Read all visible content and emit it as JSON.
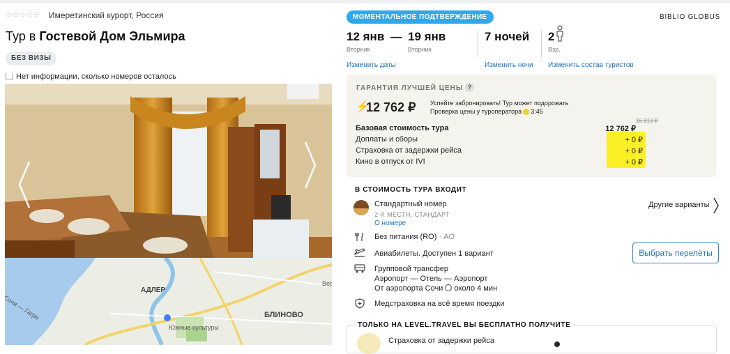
{
  "hotel": {
    "stars_glyph": "☆☆☆☆☆",
    "location": "Имеретинский курорт, Россия",
    "title_prefix": "Тур в",
    "title_name": "Гостевой Дом Эльмира",
    "visa_badge": "БЕЗ ВИЗЫ",
    "rooms_info": "Нет информации, сколько номеров осталось"
  },
  "map": {
    "labels": [
      "АДЛЕР",
      "БЛИНОВО",
      "Сочи — Гагре",
      "Южные культуры",
      "Вер"
    ]
  },
  "booking": {
    "instant_badge": "МОМЕНТАЛЬНОЕ ПОДТВЕРЖДЕНИЕ",
    "operator": "BIBLIO GLOBUS",
    "date_from": "12 янв",
    "date_dash": "—",
    "date_to": "19 янв",
    "day_from": "Вторник",
    "day_to": "Вторник",
    "nights": "7 ночей",
    "tourists_count": "2",
    "tourists_label": "Взр.",
    "change_dates": "Изменить даты",
    "change_nights": "Изменить ночи",
    "change_tourists": "Изменить состав туристов"
  },
  "guarantee": {
    "label": "ГАРАНТИЯ ЛУЧШЕЙ ЦЕНЫ",
    "help": "?",
    "price": "12 762 ₽",
    "hint_line1": "Успейте забронировать! Тур может подорожать",
    "hint_line2": "Проверка цены у туроператора",
    "timer": "3:45",
    "rows": [
      {
        "label": "Базовая стоимость тура",
        "value": "12 762 ₽",
        "old": "16 813 ₽"
      },
      {
        "label": "Доплаты и сборы",
        "value": "+ 0 ₽"
      },
      {
        "label": "Страховка от задержки рейса",
        "value": "+ 0 ₽"
      },
      {
        "label": "Кино в отпуск от IVI",
        "value": "+ 0 ₽"
      }
    ]
  },
  "included": {
    "title": "В СТОИМОСТЬ ТУРА ВХОДИТ",
    "room_name": "Стандартный номер",
    "room_type": "2-Х МЕСТН. СТАНДАРТ",
    "room_link": "О номере",
    "other_options": "Другие варианты",
    "meal_name": "Без питания (RO)",
    "meal_code": "· AO",
    "flights": "Авиабилеты. Доступен 1 вариант",
    "flights_button": "Выбрать перелёты",
    "transfer_title": "Групповой трансфер",
    "transfer_route": "Аэропорт — Отель — Аэропорт",
    "transfer_from": "От аэропорта Сочи",
    "transfer_time": "около 4 мин",
    "insurance": "Медстраховка на всё время поездки"
  },
  "free": {
    "title": "ТОЛЬКО НА LEVEL.TRAVEL ВЫ БЕСПЛАТНО ПОЛУЧИТЕ",
    "item": "Страховка от задержки рейса"
  },
  "colors": {
    "accent": "#2fa8ee",
    "highlight": "#fbef26",
    "link": "#1a73c9"
  }
}
